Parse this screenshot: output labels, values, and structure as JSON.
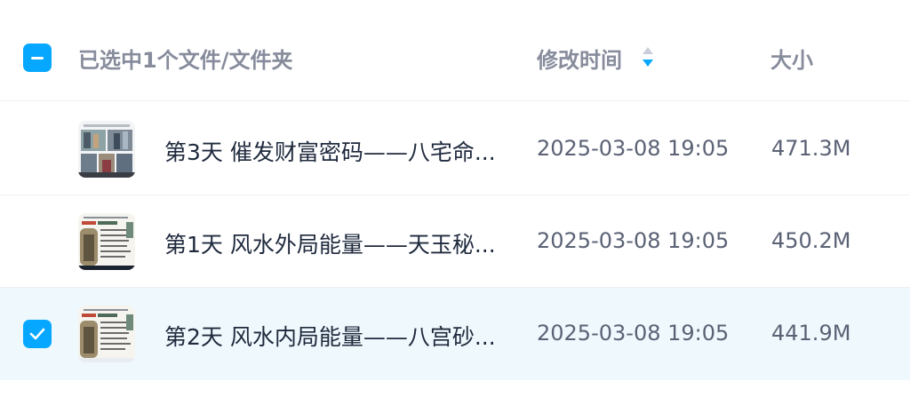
{
  "header": {
    "selection_text": "已选中1个文件/文件夹",
    "time_col": "修改时间",
    "size_col": "大小",
    "sort_icon": "sort-descending-icon"
  },
  "colors": {
    "accent": "#06a7ff",
    "selected_row_bg": "#eff8fd",
    "header_text": "#878c9c",
    "primary_text": "#1f2a3d",
    "secondary_text": "#5b6275"
  },
  "files": [
    {
      "name": "第3天 催发财富密码——八宅命...",
      "modified": "2025-03-08 19:05",
      "size": "471.3M",
      "selected": false,
      "thumbnail": "video-thumbnail-photos"
    },
    {
      "name": "第1天 风水外局能量——天玉秘...",
      "modified": "2025-03-08 19:05",
      "size": "450.2M",
      "selected": false,
      "thumbnail": "video-thumbnail-document"
    },
    {
      "name": "第2天 风水内局能量——八宫砂...",
      "modified": "2025-03-08 19:05",
      "size": "441.9M",
      "selected": true,
      "thumbnail": "video-thumbnail-document"
    }
  ]
}
